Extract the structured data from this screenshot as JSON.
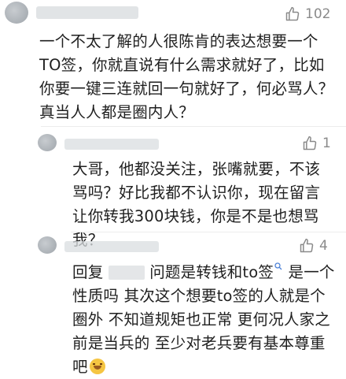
{
  "comments": [
    {
      "likes": "102",
      "text": "一个不太了解的人很陈肯的表达想要一个TO签，你就直说有什么需求就好了，比如你要一键三连就回一句就好了，何必骂人？真当人人都是圈内人？"
    },
    {
      "likes": "1",
      "text": "大哥，他都没关注，张嘴就要，不该骂吗？好比我都不认识你，现在留言让你转我300块钱，你是不是也想骂我？"
    },
    {
      "likes": "4",
      "reply_prefix": "回复",
      "text": "问题是转钱和to签",
      "text2": "是一个性质吗 其次这个想要to签的人就是个圈外 不知道规矩也正常 更何况人家之前是当兵的 至少对老兵要有基本尊重吧"
    }
  ],
  "icons": {
    "like": "thumbs-up-icon",
    "emoji": "laughing-emoji-icon",
    "search": "search-icon"
  }
}
